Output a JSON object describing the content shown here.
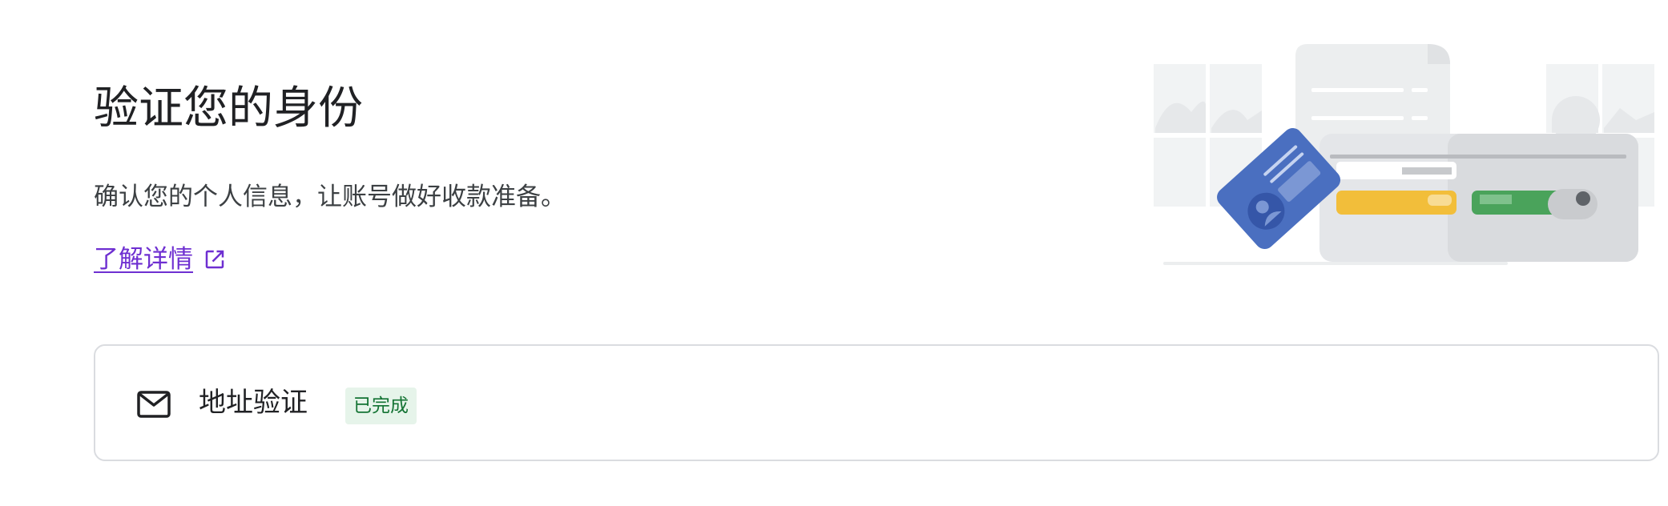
{
  "header": {
    "title": "验证您的身份",
    "subtitle": "确认您的个人信息，让账号做好收款准备。",
    "learn_more_label": "了解详情",
    "learn_more_icon": "open-in-new-icon"
  },
  "illustration": {
    "name": "identity-verification-illustration",
    "colors": {
      "id_card": "#4a6fc0",
      "id_card_dark": "#3556a8",
      "yellow_card": "#f2be3a",
      "green_card": "#4aa35b",
      "wallet": "#e4e6e9",
      "background_blocks": "#f1f3f4"
    }
  },
  "verification_items": [
    {
      "icon": "mail-icon",
      "title": "地址验证",
      "status": "已完成",
      "status_color": "#137333",
      "status_bg": "#e6f4ea"
    }
  ],
  "colors": {
    "link": "#6e2fd1",
    "border": "#dadce0",
    "text_primary": "#202124"
  }
}
